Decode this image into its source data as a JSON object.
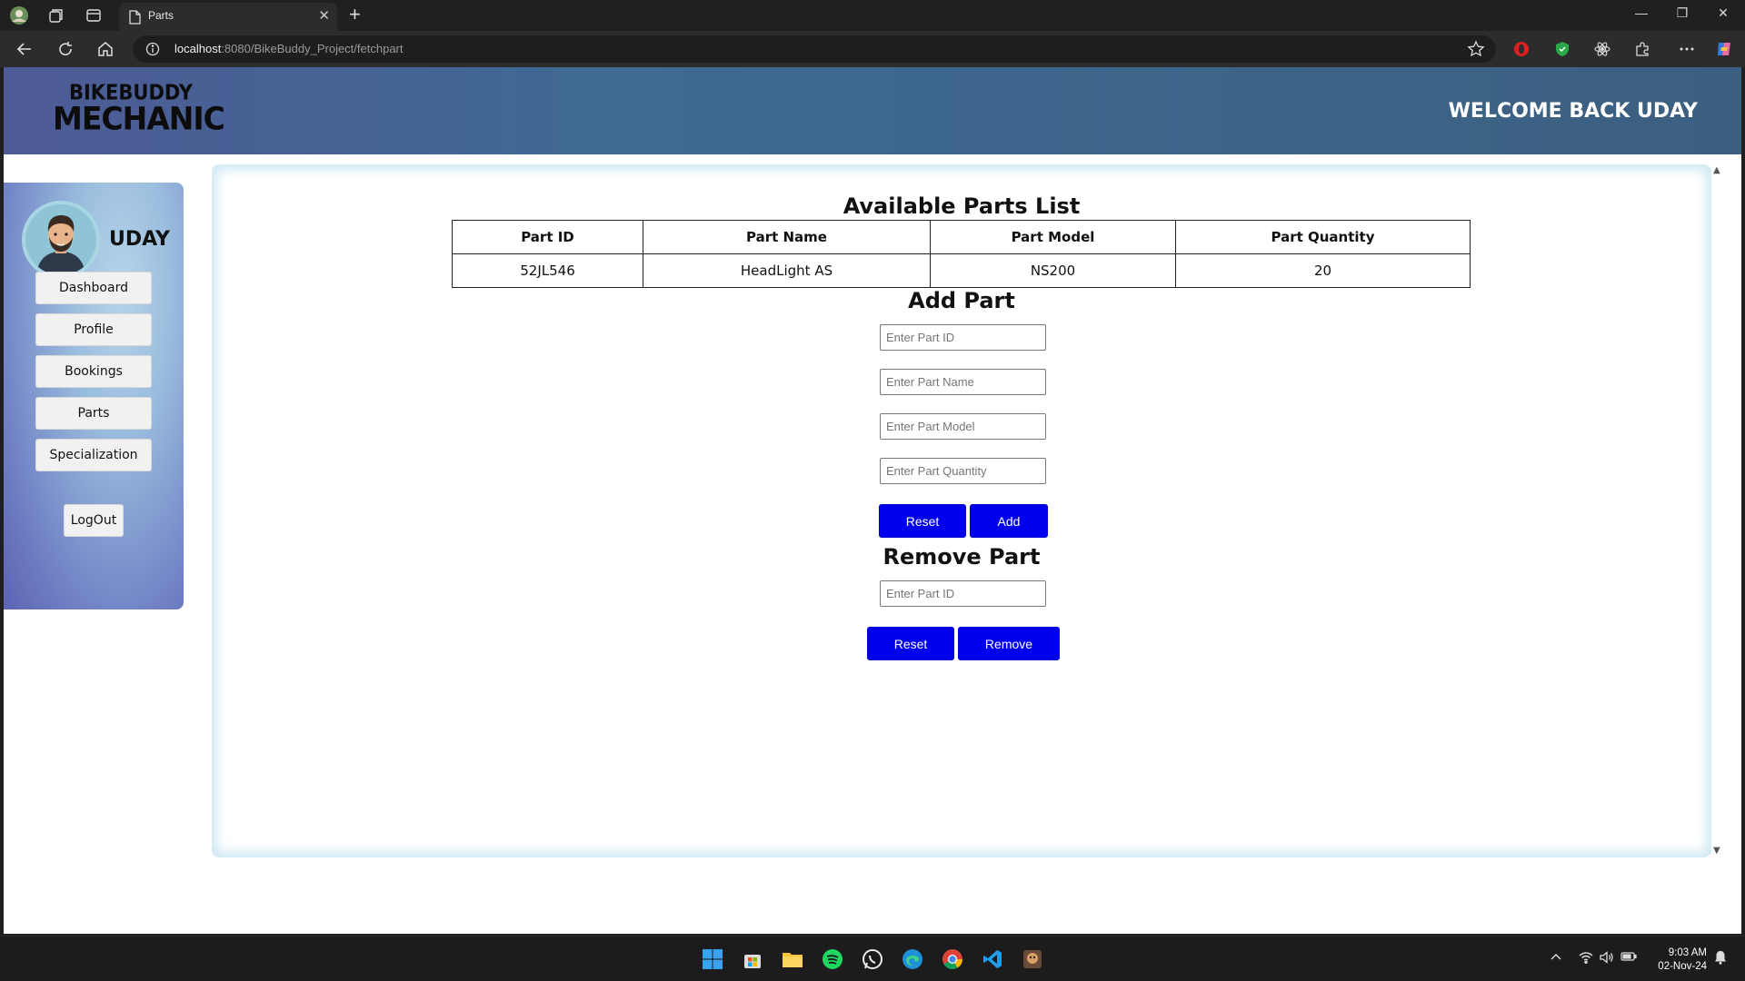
{
  "browser": {
    "tab_title": "Parts",
    "url_host": "localhost",
    "url_rest": ":8080/BikeBuddy_Project/fetchpart",
    "new_tab": "+",
    "close_tab": "✕"
  },
  "header": {
    "logo_line1": "BIKEBUDDY",
    "logo_line2": "MECHANIC",
    "welcome": "WELCOME BACK UDAY"
  },
  "sidebar": {
    "username": "UDAY",
    "items": [
      {
        "label": "Dashboard"
      },
      {
        "label": "Profile"
      },
      {
        "label": "Bookings"
      },
      {
        "label": "Parts"
      },
      {
        "label": "Specialization"
      }
    ],
    "logout": "LogOut"
  },
  "parts_list": {
    "title": "Available Parts List",
    "columns": [
      "Part ID",
      "Part Name",
      "Part Model",
      "Part Quantity"
    ],
    "rows": [
      [
        "52JL546",
        "HeadLight AS",
        "NS200",
        "20"
      ]
    ]
  },
  "add_part": {
    "title": "Add Part",
    "id_placeholder": "Enter Part ID",
    "name_placeholder": "Enter Part Name",
    "model_placeholder": "Enter Part Model",
    "quantity_placeholder": "Enter Part Quantity",
    "reset_label": "Reset",
    "add_label": "Add"
  },
  "remove_part": {
    "title": "Remove Part",
    "id_placeholder": "Enter Part ID",
    "reset_label": "Reset",
    "remove_label": "Remove"
  },
  "taskbar": {
    "time": "9:03 AM",
    "date": "02-Nov-24"
  },
  "colors": {
    "button_blue": "#0000ee",
    "header_gradient_start": "#4e5b96",
    "header_gradient_end": "#3b5f80"
  }
}
